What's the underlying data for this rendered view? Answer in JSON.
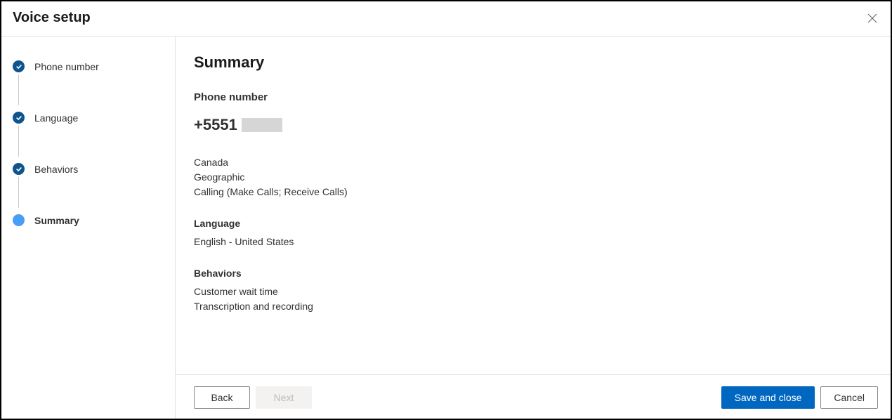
{
  "title": "Voice setup",
  "steps": [
    {
      "label": "Phone number",
      "state": "done"
    },
    {
      "label": "Language",
      "state": "done"
    },
    {
      "label": "Behaviors",
      "state": "done"
    },
    {
      "label": "Summary",
      "state": "current"
    }
  ],
  "summary": {
    "heading": "Summary",
    "sections": {
      "phone_number": {
        "label": "Phone number",
        "value": "+5551",
        "country": "Canada",
        "type": "Geographic",
        "capabilities": "Calling (Make Calls; Receive Calls)"
      },
      "language": {
        "label": "Language",
        "value": "English - United States"
      },
      "behaviors": {
        "label": "Behaviors",
        "items": [
          "Customer wait time",
          "Transcription and recording"
        ]
      }
    }
  },
  "buttons": {
    "back": "Back",
    "next": "Next",
    "save": "Save and close",
    "cancel": "Cancel"
  }
}
